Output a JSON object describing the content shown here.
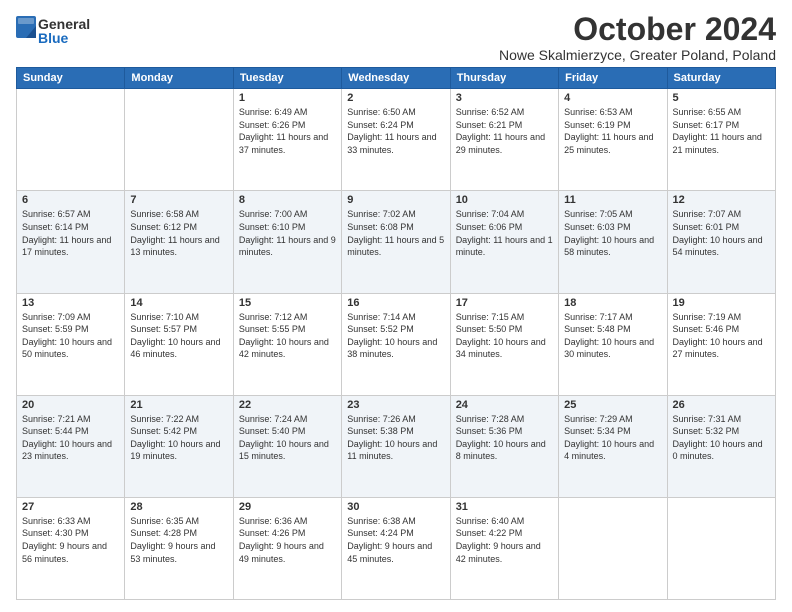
{
  "header": {
    "logo_general": "General",
    "logo_blue": "Blue",
    "month": "October 2024",
    "location": "Nowe Skalmierzyce, Greater Poland, Poland"
  },
  "weekdays": [
    "Sunday",
    "Monday",
    "Tuesday",
    "Wednesday",
    "Thursday",
    "Friday",
    "Saturday"
  ],
  "weeks": [
    [
      {
        "day": "",
        "sunrise": "",
        "sunset": "",
        "daylight": ""
      },
      {
        "day": "",
        "sunrise": "",
        "sunset": "",
        "daylight": ""
      },
      {
        "day": "1",
        "sunrise": "Sunrise: 6:49 AM",
        "sunset": "Sunset: 6:26 PM",
        "daylight": "Daylight: 11 hours and 37 minutes."
      },
      {
        "day": "2",
        "sunrise": "Sunrise: 6:50 AM",
        "sunset": "Sunset: 6:24 PM",
        "daylight": "Daylight: 11 hours and 33 minutes."
      },
      {
        "day": "3",
        "sunrise": "Sunrise: 6:52 AM",
        "sunset": "Sunset: 6:21 PM",
        "daylight": "Daylight: 11 hours and 29 minutes."
      },
      {
        "day": "4",
        "sunrise": "Sunrise: 6:53 AM",
        "sunset": "Sunset: 6:19 PM",
        "daylight": "Daylight: 11 hours and 25 minutes."
      },
      {
        "day": "5",
        "sunrise": "Sunrise: 6:55 AM",
        "sunset": "Sunset: 6:17 PM",
        "daylight": "Daylight: 11 hours and 21 minutes."
      }
    ],
    [
      {
        "day": "6",
        "sunrise": "Sunrise: 6:57 AM",
        "sunset": "Sunset: 6:14 PM",
        "daylight": "Daylight: 11 hours and 17 minutes."
      },
      {
        "day": "7",
        "sunrise": "Sunrise: 6:58 AM",
        "sunset": "Sunset: 6:12 PM",
        "daylight": "Daylight: 11 hours and 13 minutes."
      },
      {
        "day": "8",
        "sunrise": "Sunrise: 7:00 AM",
        "sunset": "Sunset: 6:10 PM",
        "daylight": "Daylight: 11 hours and 9 minutes."
      },
      {
        "day": "9",
        "sunrise": "Sunrise: 7:02 AM",
        "sunset": "Sunset: 6:08 PM",
        "daylight": "Daylight: 11 hours and 5 minutes."
      },
      {
        "day": "10",
        "sunrise": "Sunrise: 7:04 AM",
        "sunset": "Sunset: 6:06 PM",
        "daylight": "Daylight: 11 hours and 1 minute."
      },
      {
        "day": "11",
        "sunrise": "Sunrise: 7:05 AM",
        "sunset": "Sunset: 6:03 PM",
        "daylight": "Daylight: 10 hours and 58 minutes."
      },
      {
        "day": "12",
        "sunrise": "Sunrise: 7:07 AM",
        "sunset": "Sunset: 6:01 PM",
        "daylight": "Daylight: 10 hours and 54 minutes."
      }
    ],
    [
      {
        "day": "13",
        "sunrise": "Sunrise: 7:09 AM",
        "sunset": "Sunset: 5:59 PM",
        "daylight": "Daylight: 10 hours and 50 minutes."
      },
      {
        "day": "14",
        "sunrise": "Sunrise: 7:10 AM",
        "sunset": "Sunset: 5:57 PM",
        "daylight": "Daylight: 10 hours and 46 minutes."
      },
      {
        "day": "15",
        "sunrise": "Sunrise: 7:12 AM",
        "sunset": "Sunset: 5:55 PM",
        "daylight": "Daylight: 10 hours and 42 minutes."
      },
      {
        "day": "16",
        "sunrise": "Sunrise: 7:14 AM",
        "sunset": "Sunset: 5:52 PM",
        "daylight": "Daylight: 10 hours and 38 minutes."
      },
      {
        "day": "17",
        "sunrise": "Sunrise: 7:15 AM",
        "sunset": "Sunset: 5:50 PM",
        "daylight": "Daylight: 10 hours and 34 minutes."
      },
      {
        "day": "18",
        "sunrise": "Sunrise: 7:17 AM",
        "sunset": "Sunset: 5:48 PM",
        "daylight": "Daylight: 10 hours and 30 minutes."
      },
      {
        "day": "19",
        "sunrise": "Sunrise: 7:19 AM",
        "sunset": "Sunset: 5:46 PM",
        "daylight": "Daylight: 10 hours and 27 minutes."
      }
    ],
    [
      {
        "day": "20",
        "sunrise": "Sunrise: 7:21 AM",
        "sunset": "Sunset: 5:44 PM",
        "daylight": "Daylight: 10 hours and 23 minutes."
      },
      {
        "day": "21",
        "sunrise": "Sunrise: 7:22 AM",
        "sunset": "Sunset: 5:42 PM",
        "daylight": "Daylight: 10 hours and 19 minutes."
      },
      {
        "day": "22",
        "sunrise": "Sunrise: 7:24 AM",
        "sunset": "Sunset: 5:40 PM",
        "daylight": "Daylight: 10 hours and 15 minutes."
      },
      {
        "day": "23",
        "sunrise": "Sunrise: 7:26 AM",
        "sunset": "Sunset: 5:38 PM",
        "daylight": "Daylight: 10 hours and 11 minutes."
      },
      {
        "day": "24",
        "sunrise": "Sunrise: 7:28 AM",
        "sunset": "Sunset: 5:36 PM",
        "daylight": "Daylight: 10 hours and 8 minutes."
      },
      {
        "day": "25",
        "sunrise": "Sunrise: 7:29 AM",
        "sunset": "Sunset: 5:34 PM",
        "daylight": "Daylight: 10 hours and 4 minutes."
      },
      {
        "day": "26",
        "sunrise": "Sunrise: 7:31 AM",
        "sunset": "Sunset: 5:32 PM",
        "daylight": "Daylight: 10 hours and 0 minutes."
      }
    ],
    [
      {
        "day": "27",
        "sunrise": "Sunrise: 6:33 AM",
        "sunset": "Sunset: 4:30 PM",
        "daylight": "Daylight: 9 hours and 56 minutes."
      },
      {
        "day": "28",
        "sunrise": "Sunrise: 6:35 AM",
        "sunset": "Sunset: 4:28 PM",
        "daylight": "Daylight: 9 hours and 53 minutes."
      },
      {
        "day": "29",
        "sunrise": "Sunrise: 6:36 AM",
        "sunset": "Sunset: 4:26 PM",
        "daylight": "Daylight: 9 hours and 49 minutes."
      },
      {
        "day": "30",
        "sunrise": "Sunrise: 6:38 AM",
        "sunset": "Sunset: 4:24 PM",
        "daylight": "Daylight: 9 hours and 45 minutes."
      },
      {
        "day": "31",
        "sunrise": "Sunrise: 6:40 AM",
        "sunset": "Sunset: 4:22 PM",
        "daylight": "Daylight: 9 hours and 42 minutes."
      },
      {
        "day": "",
        "sunrise": "",
        "sunset": "",
        "daylight": ""
      },
      {
        "day": "",
        "sunrise": "",
        "sunset": "",
        "daylight": ""
      }
    ]
  ]
}
